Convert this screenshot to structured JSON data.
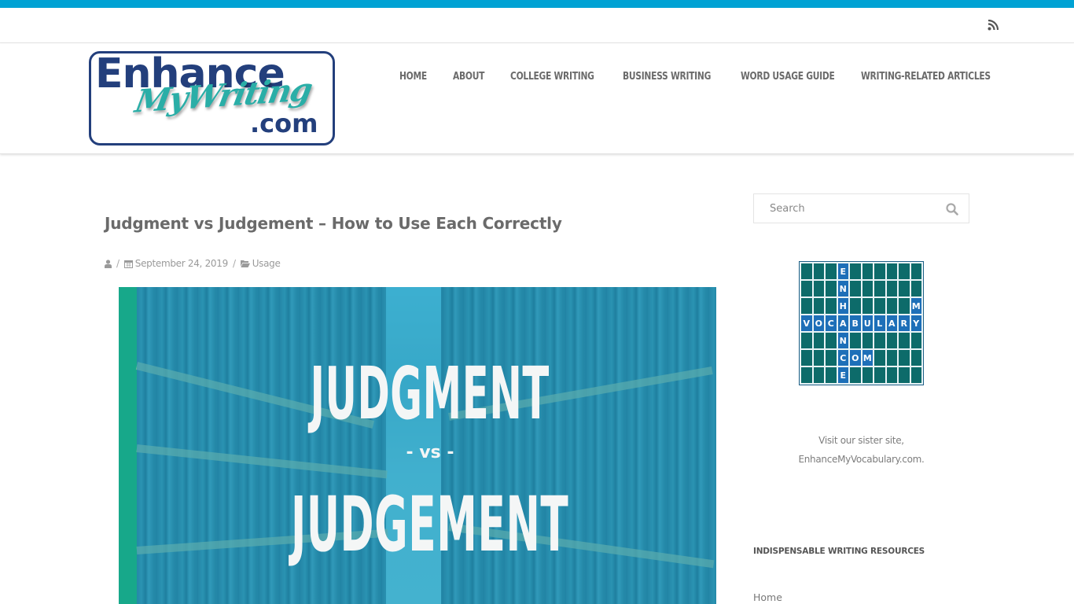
{
  "colors": {
    "top_strip": "#00a2d4",
    "logo_blue": "#233f7c",
    "logo_teal": "#2aaea7",
    "image_accent": "#17a88a",
    "vocab_cell": "#0d6b6a",
    "vocab_letter_cell": "#1d6fb8"
  },
  "topbar": {
    "rss_icon": "rss-icon"
  },
  "header": {
    "logo": {
      "line1": "Enhance",
      "line2": "MyWriting",
      "line3": ".com"
    },
    "nav": [
      {
        "label": "HOME"
      },
      {
        "label": "ABOUT"
      },
      {
        "label": "COLLEGE WRITING"
      },
      {
        "label": "BUSINESS WRITING"
      },
      {
        "label": "WORD USAGE GUIDE"
      },
      {
        "label": "WRITING-RELATED ARTICLES"
      }
    ]
  },
  "post": {
    "title": "Judgment vs Judgement – How to Use Each Correctly",
    "meta": {
      "author_icon": "user-icon",
      "separator": "/",
      "date_icon": "calendar-icon",
      "date": "September 24, 2019",
      "category_icon": "folder-open-icon",
      "category": "Usage"
    },
    "featured_image": {
      "word1": "JUDGMENT",
      "connector": "- vs -",
      "word2": "JUDGEMENT"
    }
  },
  "sidebar": {
    "search": {
      "placeholder": "Search",
      "value": "",
      "icon": "search-icon"
    },
    "vocab_grid": {
      "columns": 10,
      "rows": [
        [
          "",
          "",
          "",
          "E",
          "",
          "",
          "",
          "",
          "",
          ""
        ],
        [
          "",
          "",
          "",
          "N",
          "",
          "",
          "",
          "",
          "",
          ""
        ],
        [
          "",
          "",
          "",
          "H",
          "",
          "",
          "",
          "",
          "",
          "M"
        ],
        [
          "V",
          "O",
          "C",
          "A",
          "B",
          "U",
          "L",
          "A",
          "R",
          "Y"
        ],
        [
          "",
          "",
          "",
          "N",
          "",
          "",
          "",
          "",
          "",
          ""
        ],
        [
          "",
          "",
          "",
          "C",
          "O",
          "M",
          "",
          "",
          "",
          ""
        ],
        [
          "",
          "",
          "",
          "E",
          "",
          "",
          "",
          "",
          "",
          ""
        ]
      ]
    },
    "sister_line1": "Visit our sister site,",
    "sister_link": "EnhanceMyVocabulary.com.",
    "resources_title": "INDISPENSABLE WRITING RESOURCES",
    "resources_links": [
      {
        "label": "Home"
      }
    ]
  }
}
